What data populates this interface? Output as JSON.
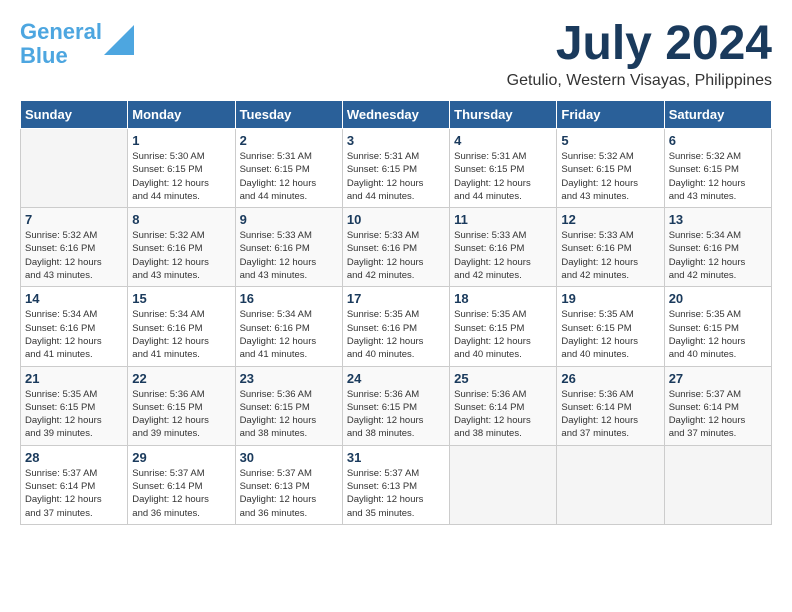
{
  "header": {
    "logo_line1": "General",
    "logo_line2": "Blue",
    "month_year": "July 2024",
    "location": "Getulio, Western Visayas, Philippines"
  },
  "calendar": {
    "days_of_week": [
      "Sunday",
      "Monday",
      "Tuesday",
      "Wednesday",
      "Thursday",
      "Friday",
      "Saturday"
    ],
    "weeks": [
      [
        {
          "day": "",
          "info": ""
        },
        {
          "day": "1",
          "info": "Sunrise: 5:30 AM\nSunset: 6:15 PM\nDaylight: 12 hours\nand 44 minutes."
        },
        {
          "day": "2",
          "info": "Sunrise: 5:31 AM\nSunset: 6:15 PM\nDaylight: 12 hours\nand 44 minutes."
        },
        {
          "day": "3",
          "info": "Sunrise: 5:31 AM\nSunset: 6:15 PM\nDaylight: 12 hours\nand 44 minutes."
        },
        {
          "day": "4",
          "info": "Sunrise: 5:31 AM\nSunset: 6:15 PM\nDaylight: 12 hours\nand 44 minutes."
        },
        {
          "day": "5",
          "info": "Sunrise: 5:32 AM\nSunset: 6:15 PM\nDaylight: 12 hours\nand 43 minutes."
        },
        {
          "day": "6",
          "info": "Sunrise: 5:32 AM\nSunset: 6:15 PM\nDaylight: 12 hours\nand 43 minutes."
        }
      ],
      [
        {
          "day": "7",
          "info": "Sunrise: 5:32 AM\nSunset: 6:16 PM\nDaylight: 12 hours\nand 43 minutes."
        },
        {
          "day": "8",
          "info": "Sunrise: 5:32 AM\nSunset: 6:16 PM\nDaylight: 12 hours\nand 43 minutes."
        },
        {
          "day": "9",
          "info": "Sunrise: 5:33 AM\nSunset: 6:16 PM\nDaylight: 12 hours\nand 43 minutes."
        },
        {
          "day": "10",
          "info": "Sunrise: 5:33 AM\nSunset: 6:16 PM\nDaylight: 12 hours\nand 42 minutes."
        },
        {
          "day": "11",
          "info": "Sunrise: 5:33 AM\nSunset: 6:16 PM\nDaylight: 12 hours\nand 42 minutes."
        },
        {
          "day": "12",
          "info": "Sunrise: 5:33 AM\nSunset: 6:16 PM\nDaylight: 12 hours\nand 42 minutes."
        },
        {
          "day": "13",
          "info": "Sunrise: 5:34 AM\nSunset: 6:16 PM\nDaylight: 12 hours\nand 42 minutes."
        }
      ],
      [
        {
          "day": "14",
          "info": "Sunrise: 5:34 AM\nSunset: 6:16 PM\nDaylight: 12 hours\nand 41 minutes."
        },
        {
          "day": "15",
          "info": "Sunrise: 5:34 AM\nSunset: 6:16 PM\nDaylight: 12 hours\nand 41 minutes."
        },
        {
          "day": "16",
          "info": "Sunrise: 5:34 AM\nSunset: 6:16 PM\nDaylight: 12 hours\nand 41 minutes."
        },
        {
          "day": "17",
          "info": "Sunrise: 5:35 AM\nSunset: 6:16 PM\nDaylight: 12 hours\nand 40 minutes."
        },
        {
          "day": "18",
          "info": "Sunrise: 5:35 AM\nSunset: 6:15 PM\nDaylight: 12 hours\nand 40 minutes."
        },
        {
          "day": "19",
          "info": "Sunrise: 5:35 AM\nSunset: 6:15 PM\nDaylight: 12 hours\nand 40 minutes."
        },
        {
          "day": "20",
          "info": "Sunrise: 5:35 AM\nSunset: 6:15 PM\nDaylight: 12 hours\nand 40 minutes."
        }
      ],
      [
        {
          "day": "21",
          "info": "Sunrise: 5:35 AM\nSunset: 6:15 PM\nDaylight: 12 hours\nand 39 minutes."
        },
        {
          "day": "22",
          "info": "Sunrise: 5:36 AM\nSunset: 6:15 PM\nDaylight: 12 hours\nand 39 minutes."
        },
        {
          "day": "23",
          "info": "Sunrise: 5:36 AM\nSunset: 6:15 PM\nDaylight: 12 hours\nand 38 minutes."
        },
        {
          "day": "24",
          "info": "Sunrise: 5:36 AM\nSunset: 6:15 PM\nDaylight: 12 hours\nand 38 minutes."
        },
        {
          "day": "25",
          "info": "Sunrise: 5:36 AM\nSunset: 6:14 PM\nDaylight: 12 hours\nand 38 minutes."
        },
        {
          "day": "26",
          "info": "Sunrise: 5:36 AM\nSunset: 6:14 PM\nDaylight: 12 hours\nand 37 minutes."
        },
        {
          "day": "27",
          "info": "Sunrise: 5:37 AM\nSunset: 6:14 PM\nDaylight: 12 hours\nand 37 minutes."
        }
      ],
      [
        {
          "day": "28",
          "info": "Sunrise: 5:37 AM\nSunset: 6:14 PM\nDaylight: 12 hours\nand 37 minutes."
        },
        {
          "day": "29",
          "info": "Sunrise: 5:37 AM\nSunset: 6:14 PM\nDaylight: 12 hours\nand 36 minutes."
        },
        {
          "day": "30",
          "info": "Sunrise: 5:37 AM\nSunset: 6:13 PM\nDaylight: 12 hours\nand 36 minutes."
        },
        {
          "day": "31",
          "info": "Sunrise: 5:37 AM\nSunset: 6:13 PM\nDaylight: 12 hours\nand 35 minutes."
        },
        {
          "day": "",
          "info": ""
        },
        {
          "day": "",
          "info": ""
        },
        {
          "day": "",
          "info": ""
        }
      ]
    ]
  }
}
